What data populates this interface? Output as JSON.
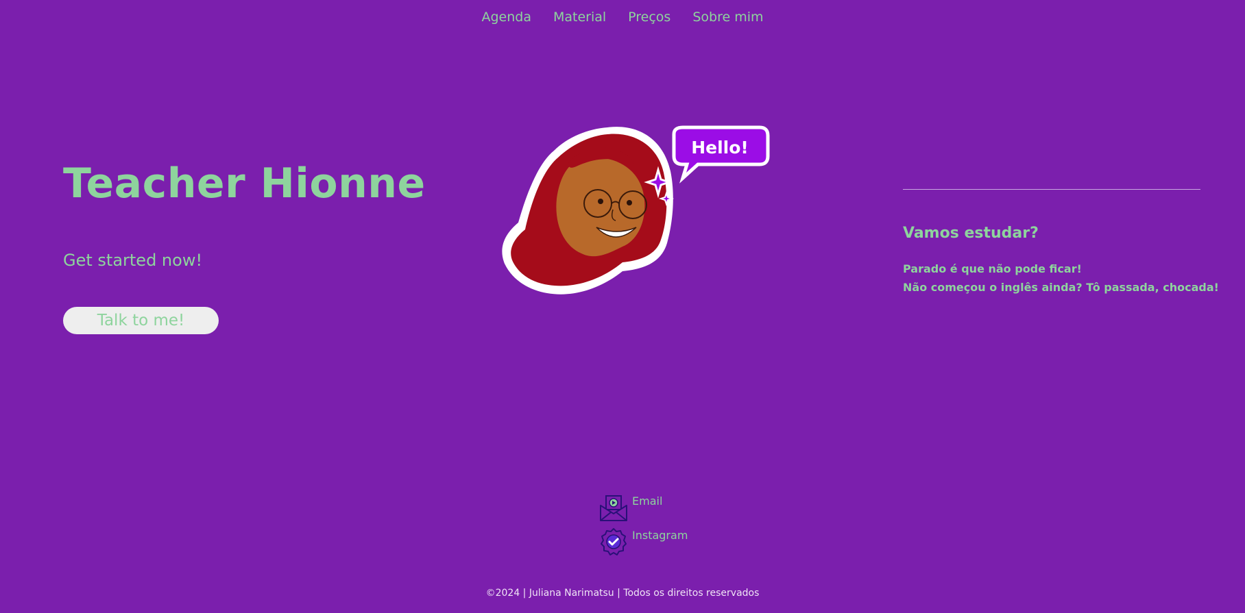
{
  "nav": {
    "items": [
      {
        "label": "Agenda"
      },
      {
        "label": "Material"
      },
      {
        "label": "Preços"
      },
      {
        "label": "Sobre mim"
      }
    ]
  },
  "hero": {
    "title": "Teacher Hionne",
    "subtitle": "Get started now!",
    "cta_label": "Talk to me!"
  },
  "avatar": {
    "speech_bubble": "Hello!"
  },
  "side": {
    "title": "Vamos estudar?",
    "lines": [
      "Parado é que não pode ficar!",
      "Não começou o inglês ainda? Tô passada, chocada!"
    ]
  },
  "contacts": [
    {
      "label": "Email",
      "icon": "email-icon"
    },
    {
      "label": "Instagram",
      "icon": "verified-badge-icon"
    }
  ],
  "footer": {
    "text": "©2024 | Juliana Narimatsu | Todos os direitos reservados"
  },
  "colors": {
    "background": "#7b1fad",
    "accent_green": "#8ed49d",
    "bubble_purple": "#9b0de6",
    "hair_red": "#a50c1a",
    "skin": "#b8692a",
    "button_bg": "#eeeeee"
  }
}
